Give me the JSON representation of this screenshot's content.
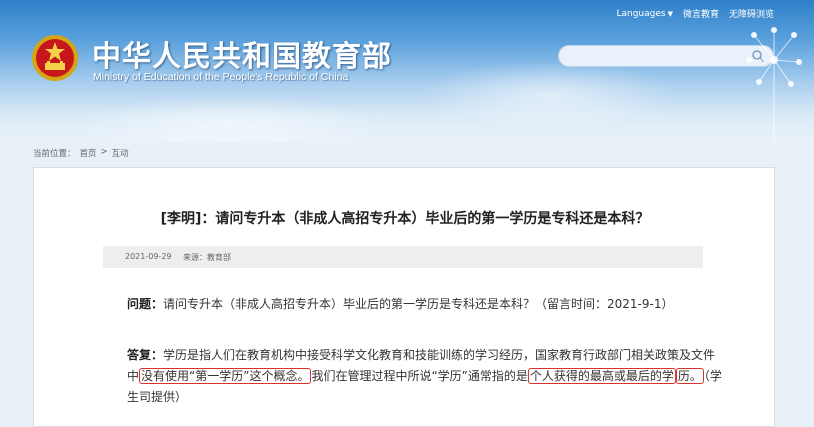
{
  "header": {
    "nav": {
      "languages": "Languages",
      "weibo": "微言教育",
      "accessibility": "无障碍浏览"
    },
    "logo_cn": "中华人民共和国教育部",
    "logo_en": "Ministry of Education of the People's Republic of China",
    "search": {
      "value": "",
      "placeholder": ""
    }
  },
  "breadcrumb": {
    "prefix": "当前位置：",
    "home": "首页",
    "sep": ">",
    "current": "互动"
  },
  "article": {
    "title": "[李明]：请问专升本（非成人高招专升本）毕业后的第一学历是专科还是本科？",
    "date": "2021-09-29",
    "source": "来源：教育部",
    "question_label": "问题：",
    "question_text": "请问专升本（非成人高招专升本）毕业后的第一学历是专科还是本科？（留言时间：2021-9-1）",
    "answer_label": "答复：",
    "answer_parts": {
      "p1": "学历是指人们在教育机构中接受科学文化教育和技能训练的学习经历，国家教育行政部门相关政策及文件中",
      "h1": "没有使用“第一学历”这个概念。",
      "p2": "我们在管理过程中所说“学历”通常指的是",
      "h2": "个人获得的最高或最后的学",
      "h3": "历。",
      "p3": "（学生司提供）"
    }
  },
  "colors": {
    "header_top": "#2f80c8",
    "highlight_border": "#d8322e"
  }
}
